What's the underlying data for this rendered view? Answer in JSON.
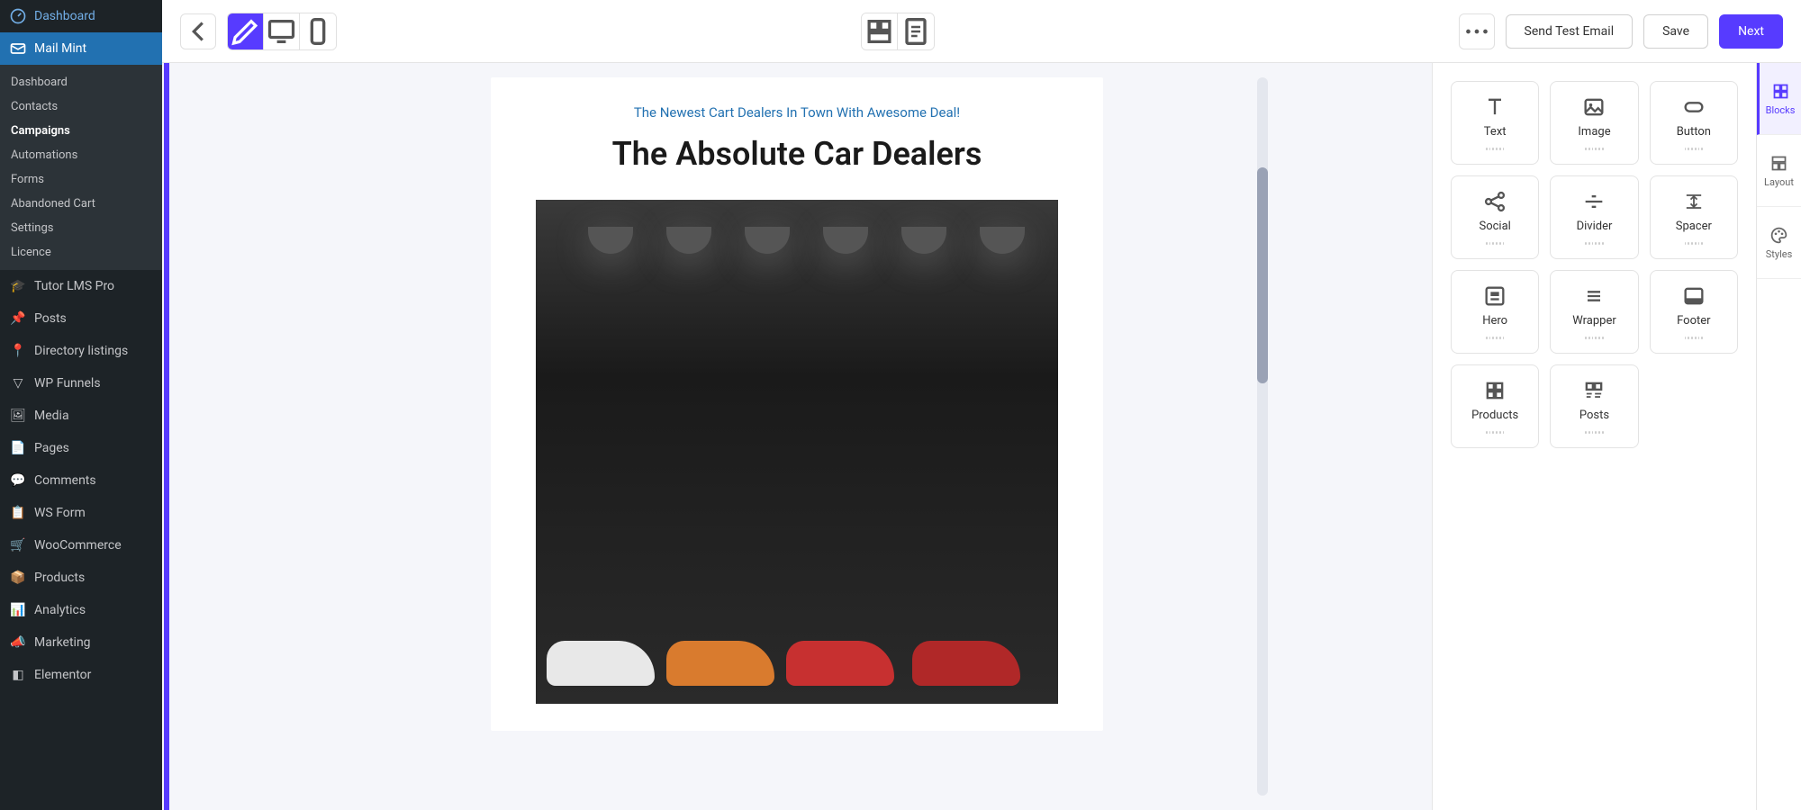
{
  "sidebar": {
    "main_top": {
      "label": "Dashboard",
      "icon": "gauge-icon"
    },
    "mail_mint": {
      "label": "Mail Mint",
      "icon": "envelope-icon"
    },
    "submenu": [
      {
        "label": "Dashboard",
        "active": false
      },
      {
        "label": "Contacts",
        "active": false
      },
      {
        "label": "Campaigns",
        "active": true
      },
      {
        "label": "Automations",
        "active": false
      },
      {
        "label": "Forms",
        "active": false
      },
      {
        "label": "Abandoned Cart",
        "active": false
      },
      {
        "label": "Settings",
        "active": false
      },
      {
        "label": "Licence",
        "active": false
      }
    ],
    "rest": [
      {
        "label": "Tutor LMS Pro",
        "icon": "graduation-icon"
      },
      {
        "label": "Posts",
        "icon": "pin-icon"
      },
      {
        "label": "Directory listings",
        "icon": "location-icon"
      },
      {
        "label": "WP Funnels",
        "icon": "funnel-icon"
      },
      {
        "label": "Media",
        "icon": "media-icon"
      },
      {
        "label": "Pages",
        "icon": "page-icon"
      },
      {
        "label": "Comments",
        "icon": "comment-icon"
      },
      {
        "label": "WS Form",
        "icon": "form-icon"
      },
      {
        "label": "WooCommerce",
        "icon": "woo-icon"
      },
      {
        "label": "Products",
        "icon": "products-icon"
      },
      {
        "label": "Analytics",
        "icon": "analytics-icon"
      },
      {
        "label": "Marketing",
        "icon": "megaphone-icon"
      },
      {
        "label": "Elementor",
        "icon": "elementor-icon"
      }
    ]
  },
  "toolbar": {
    "send_test": "Send Test Email",
    "save": "Save",
    "next": "Next"
  },
  "canvas": {
    "subtitle": "The Newest Cart Dealers In Town With Awesome Deal!",
    "title": "The Absolute Car Dealers"
  },
  "blocks": [
    {
      "label": "Text",
      "icon": "text-icon"
    },
    {
      "label": "Image",
      "icon": "image-icon"
    },
    {
      "label": "Button",
      "icon": "button-icon"
    },
    {
      "label": "Social",
      "icon": "social-icon"
    },
    {
      "label": "Divider",
      "icon": "divider-icon"
    },
    {
      "label": "Spacer",
      "icon": "spacer-icon"
    },
    {
      "label": "Hero",
      "icon": "hero-icon"
    },
    {
      "label": "Wrapper",
      "icon": "wrapper-icon"
    },
    {
      "label": "Footer",
      "icon": "footer-icon"
    },
    {
      "label": "Products",
      "icon": "products-block-icon"
    },
    {
      "label": "Posts",
      "icon": "posts-block-icon"
    }
  ],
  "side_tabs": {
    "blocks": "Blocks",
    "layout": "Layout",
    "styles": "Styles"
  }
}
